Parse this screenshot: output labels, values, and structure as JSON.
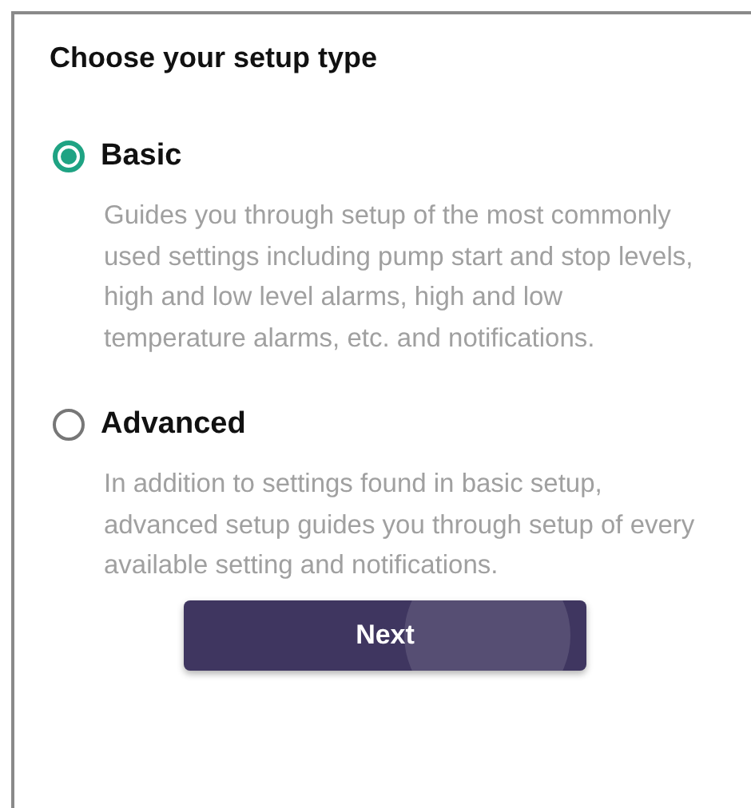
{
  "title": "Choose your setup type",
  "options": [
    {
      "label": "Basic",
      "selected": true,
      "description": "Guides you through setup of the most commonly used settings including pump start and stop levels, high and low level alarms, high and low temperature alarms, etc. and notifications."
    },
    {
      "label": "Advanced",
      "selected": false,
      "description": "In addition to settings found in basic setup, advanced setup guides you through setup of every available setting and notifications."
    }
  ],
  "button": {
    "label": "Next"
  }
}
